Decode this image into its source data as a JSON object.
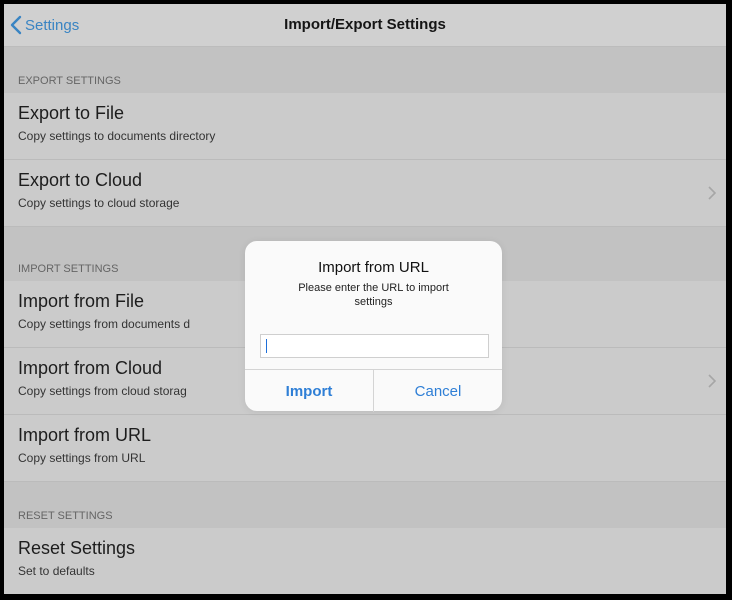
{
  "navbar": {
    "back_label": "Settings",
    "title": "Import/Export Settings"
  },
  "sections": {
    "export": {
      "header": "EXPORT SETTINGS",
      "rows": [
        {
          "title": "Export to File",
          "subtitle": "Copy settings to documents directory"
        },
        {
          "title": "Export to Cloud",
          "subtitle": "Copy settings to cloud storage"
        }
      ]
    },
    "import": {
      "header": "IMPORT SETTINGS",
      "rows": [
        {
          "title": "Import from File",
          "subtitle": "Copy settings from documents d"
        },
        {
          "title": "Import from Cloud",
          "subtitle": "Copy settings from cloud storag"
        },
        {
          "title": "Import from URL",
          "subtitle": "Copy settings from URL"
        }
      ]
    },
    "reset": {
      "header": "RESET SETTINGS",
      "rows": [
        {
          "title": "Reset Settings",
          "subtitle": "Set to defaults"
        }
      ]
    }
  },
  "alert": {
    "title": "Import from URL",
    "message": "Please enter the URL to import settings",
    "input_value": "",
    "import_label": "Import",
    "cancel_label": "Cancel"
  },
  "colors": {
    "accent": "#2f7fd6",
    "background": "#e0e0e0",
    "section_header_bg": "#d5d5d5"
  },
  "icons": [
    "chevron-left-icon",
    "chevron-right-icon"
  ]
}
